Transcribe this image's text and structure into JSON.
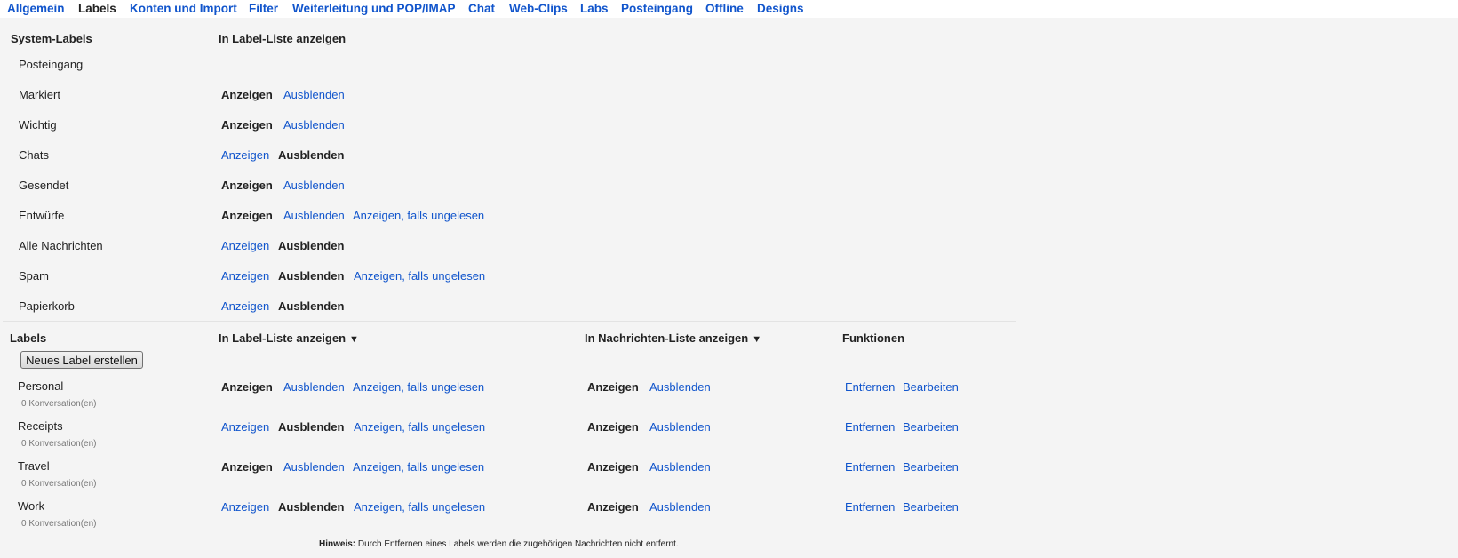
{
  "tabs": [
    "Allgemein",
    "Labels",
    "Konten und Import",
    "Filter",
    "Weiterleitung und POP/IMAP",
    "Chat",
    "Web-Clips",
    "Labs",
    "Posteingang",
    "Offline",
    "Designs"
  ],
  "active_tab": "Labels",
  "system_section": {
    "header": "System-Labels",
    "column_header": "In Label-Liste anzeigen",
    "rows": [
      {
        "name": "Posteingang"
      },
      {
        "name": "Markiert",
        "show": "Anzeigen",
        "hide": "Ausblenden",
        "selected": "show"
      },
      {
        "name": "Wichtig",
        "show": "Anzeigen",
        "hide": "Ausblenden",
        "selected": "show"
      },
      {
        "name": "Chats",
        "show": "Anzeigen",
        "hide": "Ausblenden",
        "selected": "hide"
      },
      {
        "name": "Gesendet",
        "show": "Anzeigen",
        "hide": "Ausblenden",
        "selected": "show"
      },
      {
        "name": "Entwürfe",
        "show": "Anzeigen",
        "hide": "Ausblenden",
        "unread": "Anzeigen, falls ungelesen",
        "selected": "show"
      },
      {
        "name": "Alle Nachrichten",
        "show": "Anzeigen",
        "hide": "Ausblenden",
        "selected": "hide"
      },
      {
        "name": "Spam",
        "show": "Anzeigen",
        "hide": "Ausblenden",
        "unread": "Anzeigen, falls ungelesen",
        "selected": "hide"
      },
      {
        "name": "Papierkorb",
        "show": "Anzeigen",
        "hide": "Ausblenden",
        "selected": "hide"
      }
    ]
  },
  "labels_section": {
    "header": "Labels",
    "label_list_header": "In Label-Liste anzeigen",
    "message_list_header": "In Nachrichten-Liste anzeigen",
    "actions_header": "Funktionen",
    "dropdown_arrow": "▼",
    "new_label_button": "Neues Label erstellen",
    "rows": [
      {
        "name": "Personal",
        "count": "0 Konversation(en)",
        "list_selected": "show",
        "msg_selected": "show"
      },
      {
        "name": "Receipts",
        "count": "0 Konversation(en)",
        "list_selected": "hide",
        "msg_selected": "show"
      },
      {
        "name": "Travel",
        "count": "0 Konversation(en)",
        "list_selected": "show",
        "msg_selected": "show"
      },
      {
        "name": "Work",
        "count": "0 Konversation(en)",
        "list_selected": "hide",
        "msg_selected": "show"
      }
    ],
    "show": "Anzeigen",
    "hide": "Ausblenden",
    "unread": "Anzeigen, falls ungelesen",
    "remove": "Entfernen",
    "edit": "Bearbeiten"
  },
  "note": {
    "label": "Hinweis:",
    "text": " Durch Entfernen eines Labels werden die zugehörigen Nachrichten nicht entfernt."
  }
}
